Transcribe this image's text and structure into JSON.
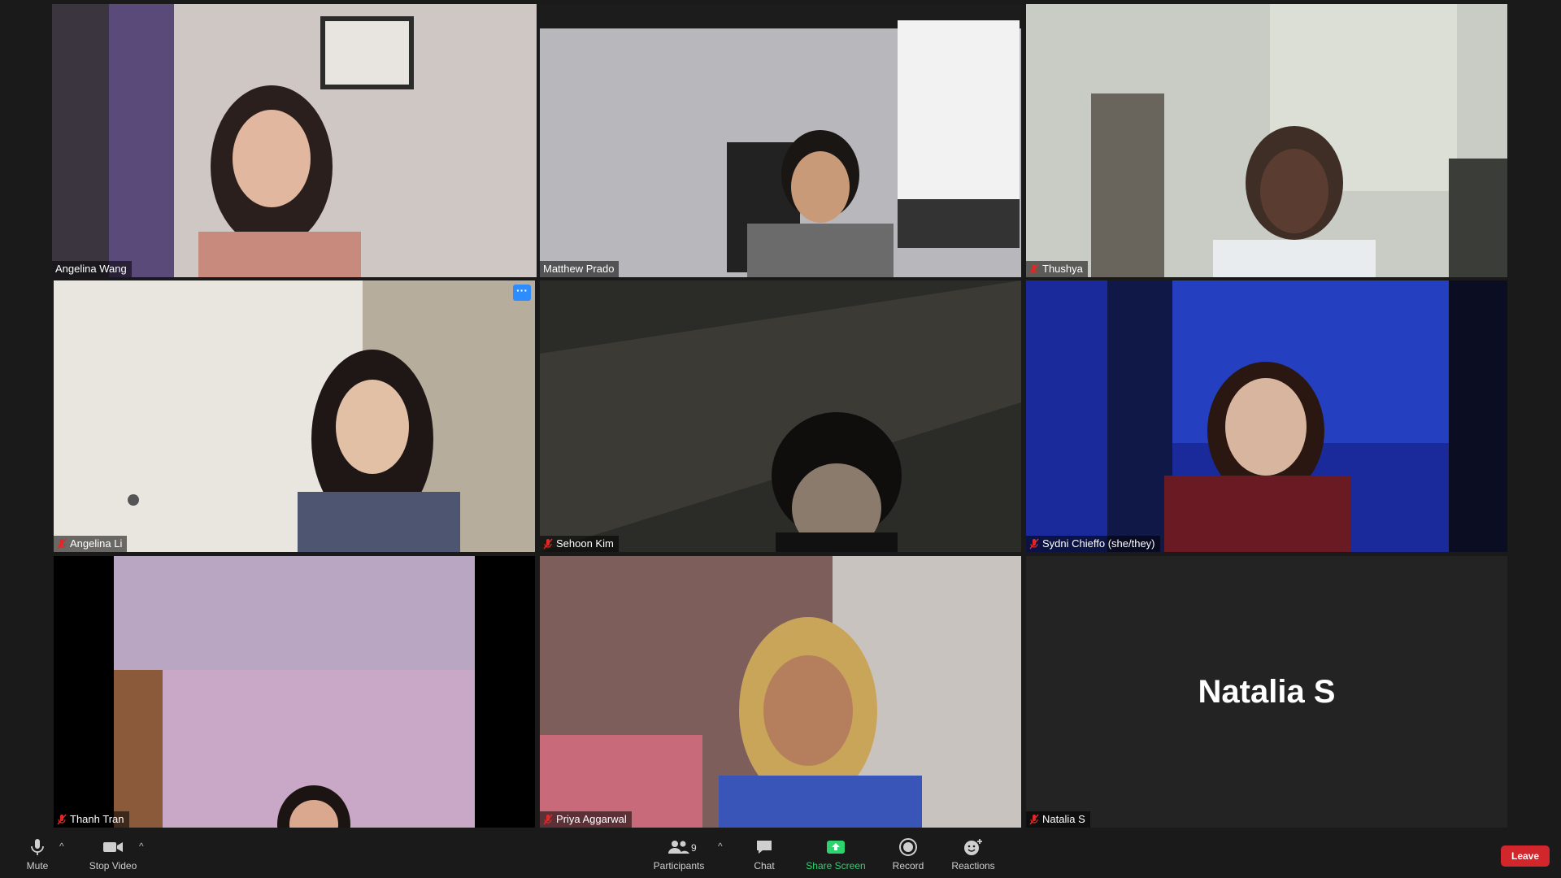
{
  "participants": [
    {
      "name": "Angelina Wang",
      "muted": false,
      "active_speaker": true
    },
    {
      "name": "Matthew Prado",
      "muted": false
    },
    {
      "name": "Thushya",
      "muted": true
    },
    {
      "name": "Angelina Li",
      "muted": true
    },
    {
      "name": "Sehoon Kim",
      "muted": true
    },
    {
      "name": "Sydni Chieffo (she/they)",
      "muted": true
    },
    {
      "name": "Thanh Tran",
      "muted": true
    },
    {
      "name": "Priya Aggarwal",
      "muted": true
    },
    {
      "name": "Natalia S",
      "muted": true,
      "video_off": true
    }
  ],
  "tile_menu_glyph": "···",
  "video_off_display_name": "Natalia S",
  "toolbar": {
    "mute_label": "Mute",
    "stop_video_label": "Stop Video",
    "participants_label": "Participants",
    "participants_count": "9",
    "chat_label": "Chat",
    "share_screen_label": "Share Screen",
    "record_label": "Record",
    "reactions_label": "Reactions",
    "leave_label": "Leave"
  },
  "colors": {
    "background": "#1a1a1a",
    "active_speaker_border": "#d6e86f",
    "share_screen_green": "#2dd36f",
    "leave_red": "#d0262c",
    "muted_icon_red": "#e02828",
    "tile_menu_blue": "#2d8cff"
  },
  "icons": {
    "mute": "microphone-icon",
    "stop_video": "video-camera-icon",
    "participants": "people-icon",
    "chat": "chat-bubble-icon",
    "share_screen": "share-screen-arrow-icon",
    "record": "record-circle-icon",
    "reactions": "smiley-plus-icon",
    "muted_indicator": "muted-mic-icon"
  }
}
